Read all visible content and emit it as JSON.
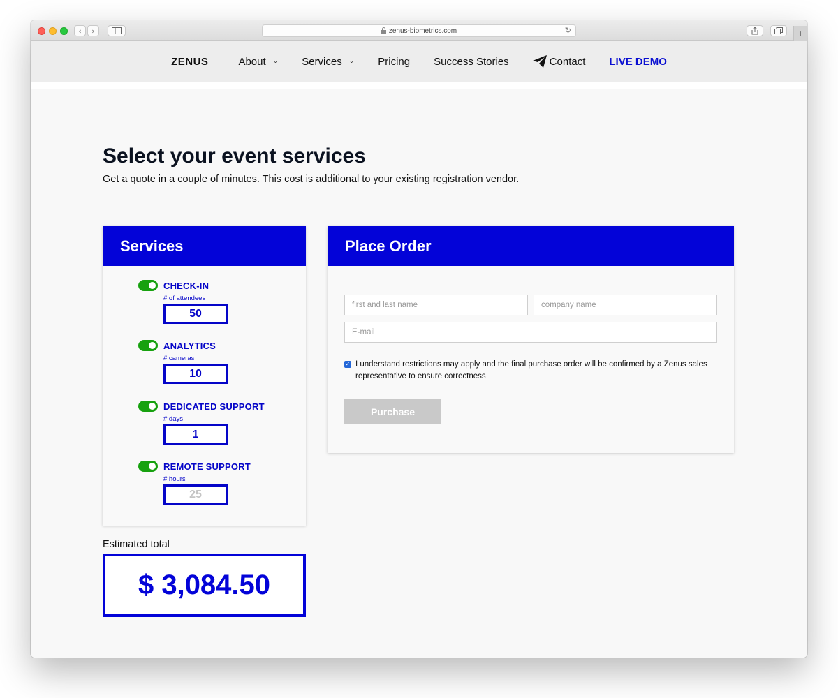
{
  "browser": {
    "url": "zenus-biometrics.com",
    "back_glyph": "‹",
    "forward_glyph": "›",
    "reload_glyph": "↻",
    "new_tab_glyph": "+"
  },
  "nav": {
    "logo": "ZENUS",
    "items": [
      {
        "label": "About",
        "has_caret": true
      },
      {
        "label": "Services",
        "has_caret": true
      },
      {
        "label": "Pricing"
      },
      {
        "label": "Success Stories"
      },
      {
        "label": "Contact",
        "icon": "paper-plane-icon"
      },
      {
        "label": "LIVE DEMO"
      }
    ],
    "caret_glyph": "⌄"
  },
  "page": {
    "title": "Select your event services",
    "subtitle": "Get a quote in a couple of minutes. This cost is additional to your existing registration vendor."
  },
  "services": {
    "heading": "Services",
    "items": [
      {
        "name": "CHECK-IN",
        "unit": "# of attendees",
        "value": "50",
        "enabled": true
      },
      {
        "name": "ANALYTICS",
        "unit": "# cameras",
        "value": "10",
        "enabled": true
      },
      {
        "name": "DEDICATED SUPPORT",
        "unit": "# days",
        "value": "1",
        "enabled": true
      },
      {
        "name": "REMOTE SUPPORT",
        "unit": "# hours",
        "value": "25",
        "enabled": true
      }
    ]
  },
  "estimate": {
    "label": "Estimated total",
    "value": "$ 3,084.50"
  },
  "order": {
    "heading": "Place Order",
    "name_placeholder": "first and last name",
    "company_placeholder": "company name",
    "email_placeholder": "E-mail",
    "consent_checked": true,
    "consent_text": "I understand restrictions may apply and the final purchase order will be confirmed by a Zenus sales representative to ensure correctness",
    "purchase_label": "Purchase"
  },
  "colors": {
    "brand_blue": "#0303d8",
    "toggle_green": "#17a10f",
    "chat_orange": "#ffb300"
  }
}
